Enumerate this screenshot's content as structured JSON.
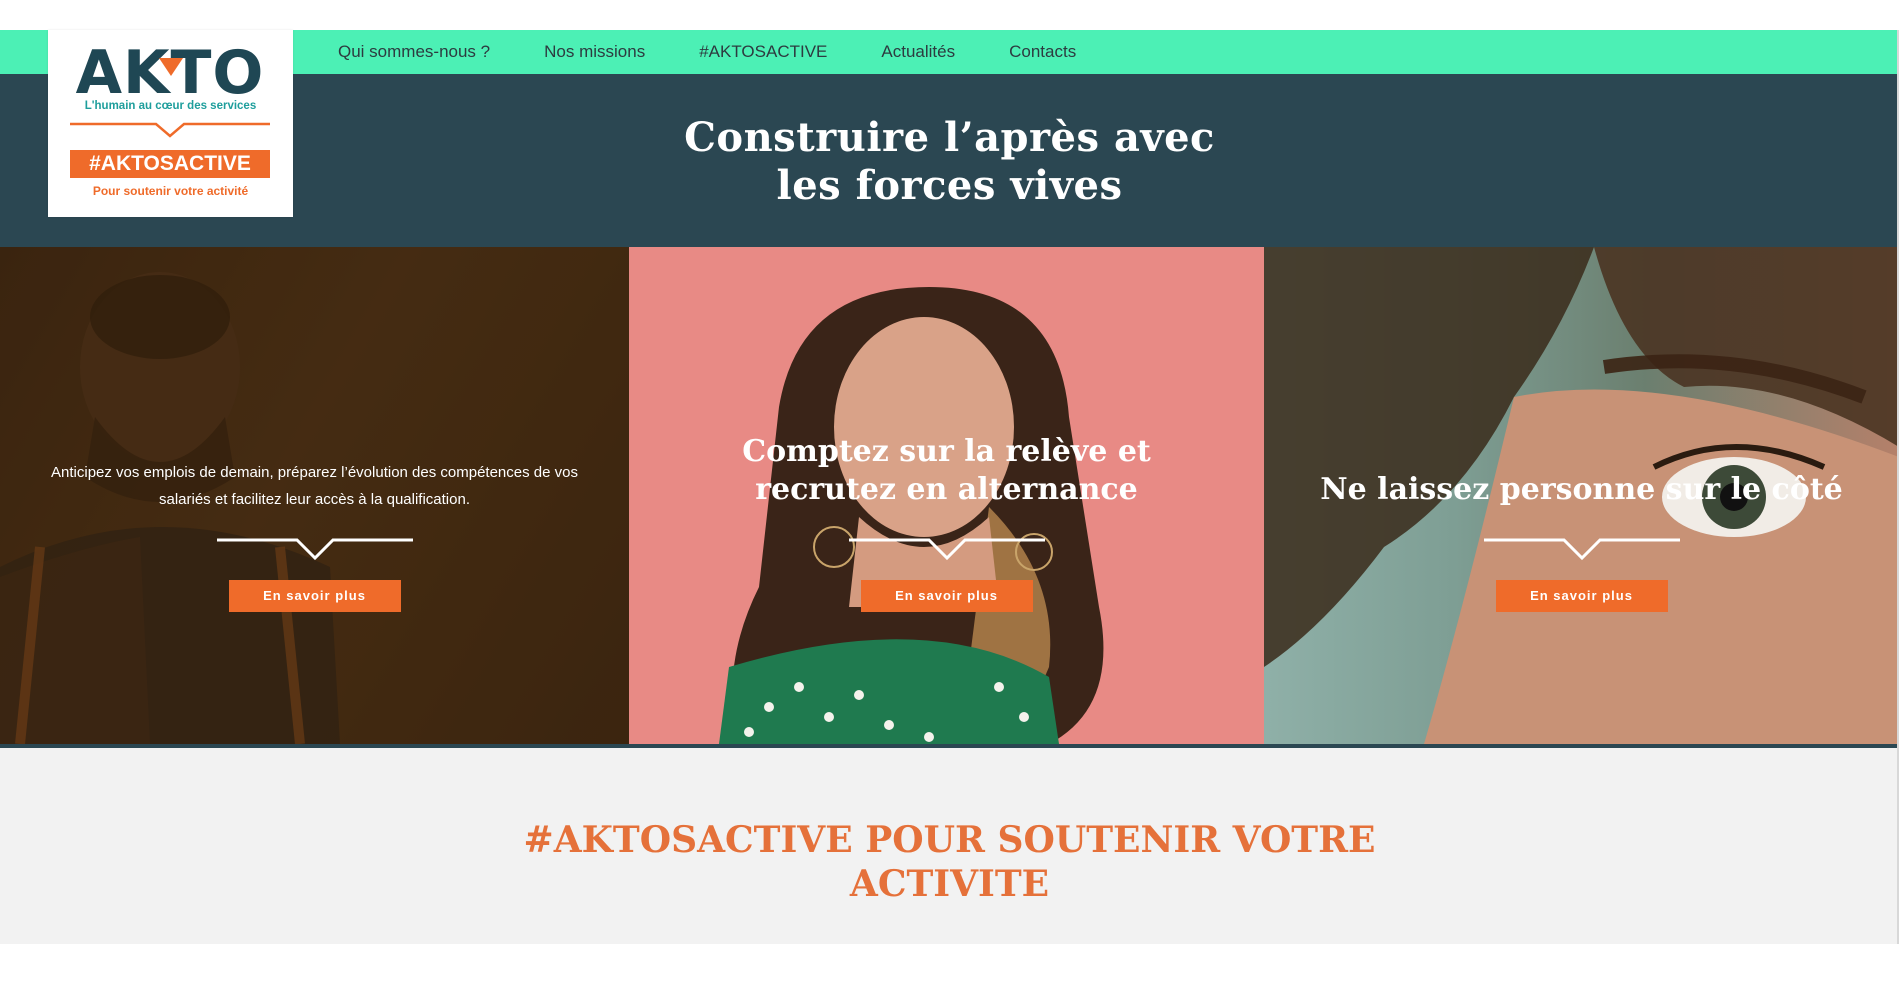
{
  "nav": {
    "items": [
      {
        "label": "Qui sommes-nous ?"
      },
      {
        "label": "Nos missions"
      },
      {
        "label": "#AKTOSACTIVE"
      },
      {
        "label": "Actualités"
      },
      {
        "label": "Contacts"
      }
    ]
  },
  "logo": {
    "wordmark": "AKTO",
    "tagline": "L'humain au cœur des services",
    "badge": "#AKTOSACTIVE",
    "subline": "Pour soutenir votre activité"
  },
  "hero": {
    "title_line1": "Construire l’après avec",
    "title_line2": "les forces vives"
  },
  "panels": [
    {
      "text": "Anticipez vos emplois de demain, préparez l’évolution des compétences de vos salariés et facilitez leur accès à la qualification.",
      "cta": "En savoir plus"
    },
    {
      "text": "Comptez sur la relève et recrutez en alternance",
      "cta": "En savoir plus"
    },
    {
      "text": "Ne laissez personne sur le côté",
      "cta": "En savoir plus"
    }
  ],
  "activity": {
    "title_line1": "#AKTOSACTIVE POUR SOUTENIR VOTRE",
    "title_line2": "ACTIVITE"
  },
  "colors": {
    "nav_bg": "#4cf0b5",
    "header_bg": "#2b4752",
    "accent_orange": "#ef6b2a",
    "logo_teal": "#1e9e9c",
    "logo_dark": "#1f4754",
    "section_bg": "#f2f2f2"
  }
}
